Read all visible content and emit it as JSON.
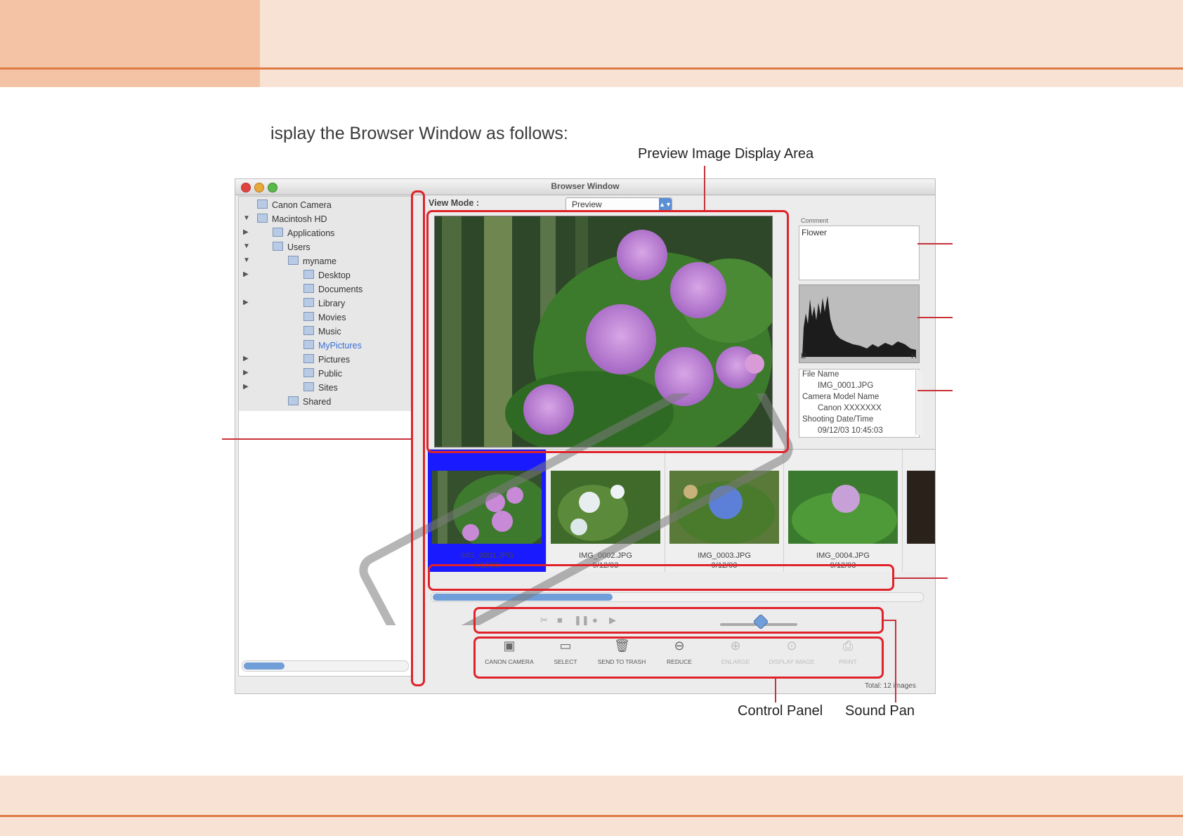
{
  "intro_text": "isplay the Browser Window as follows:",
  "callouts": {
    "preview_area": "Preview Image Display Area",
    "control_panel": "Control Panel",
    "sound_panel": "Sound Pan"
  },
  "window": {
    "title": "Browser Window",
    "view_mode_label": "View Mode :",
    "view_mode_value": "Preview",
    "comment_label": "Comment",
    "comment_text": "Flower",
    "histogram_axis": [
      "D",
      "H"
    ],
    "info": {
      "file_name_label": "File Name",
      "file_name": "IMG_0001.JPG",
      "camera_label": "Camera Model Name",
      "camera": "Canon XXXXXXX",
      "date_label": "Shooting Date/Time",
      "date": "09/12/03 10:45:03"
    },
    "tree": [
      {
        "label": "Canon Camera",
        "level": 0,
        "arrow": ""
      },
      {
        "label": "Macintosh HD",
        "level": 0,
        "arrow": "▼"
      },
      {
        "label": "Applications",
        "level": 1,
        "arrow": "▶"
      },
      {
        "label": "Users",
        "level": 1,
        "arrow": "▼"
      },
      {
        "label": "myname",
        "level": 2,
        "arrow": "▼"
      },
      {
        "label": "Desktop",
        "level": 3,
        "arrow": "▶"
      },
      {
        "label": "Documents",
        "level": 3,
        "arrow": ""
      },
      {
        "label": "Library",
        "level": 3,
        "arrow": "▶"
      },
      {
        "label": "Movies",
        "level": 3,
        "arrow": ""
      },
      {
        "label": "Music",
        "level": 3,
        "arrow": ""
      },
      {
        "label": "MyPictures",
        "level": 3,
        "arrow": ""
      },
      {
        "label": "Pictures",
        "level": 3,
        "arrow": "▶"
      },
      {
        "label": "Public",
        "level": 3,
        "arrow": "▶"
      },
      {
        "label": "Sites",
        "level": 3,
        "arrow": "▶"
      },
      {
        "label": "Shared",
        "level": 2,
        "arrow": ""
      }
    ],
    "thumbnails": [
      {
        "name": "IMG_0001.JPG",
        "date": "9/12/03"
      },
      {
        "name": "IMG_0002.JPG",
        "date": "9/12/03"
      },
      {
        "name": "IMG_0003.JPG",
        "date": "9/12/03"
      },
      {
        "name": "IMG_0004.JPG",
        "date": "9/12/03"
      }
    ],
    "control_buttons": [
      {
        "label": "CANON CAMERA",
        "icon": "camera-icon",
        "enabled": true
      },
      {
        "label": "SELECT",
        "icon": "select-icon",
        "enabled": true
      },
      {
        "label": "SEND TO TRASH",
        "icon": "trash-icon",
        "enabled": true
      },
      {
        "label": "REDUCE",
        "icon": "zoom-out-icon",
        "enabled": true
      },
      {
        "label": "ENLARGE",
        "icon": "zoom-in-icon",
        "enabled": false
      },
      {
        "label": "DISPLAY IMAGE",
        "icon": "display-image-icon",
        "enabled": false
      },
      {
        "label": "PRINT",
        "icon": "print-icon",
        "enabled": false
      }
    ],
    "status": "Total: 12 images"
  },
  "colors": {
    "header_dark": "#f4c2a4",
    "header_light": "#f8e2d4",
    "rule": "#df7a45",
    "highlight": "#e0232b",
    "selection": "#1a1aff"
  }
}
